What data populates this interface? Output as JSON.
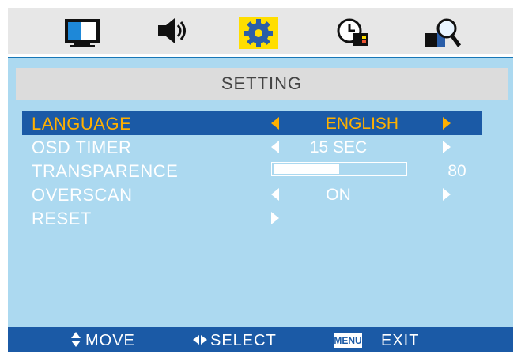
{
  "tabs": [
    {
      "name": "picture",
      "icon": "monitor-icon"
    },
    {
      "name": "audio",
      "icon": "speaker-icon"
    },
    {
      "name": "setting",
      "icon": "gear-icon",
      "active": true
    },
    {
      "name": "timer",
      "icon": "clock-icon"
    },
    {
      "name": "advanced",
      "icon": "magnifier-icon"
    }
  ],
  "panel": {
    "title": "SETTING"
  },
  "rows": [
    {
      "label": "LANGUAGE",
      "value": "ENGLISH",
      "selected": true
    },
    {
      "label": "OSD TIMER",
      "value": "15 SEC"
    },
    {
      "label": "TRANSPARENCE",
      "value": "80",
      "level": 0.5
    },
    {
      "label": "OVERSCAN",
      "value": "ON"
    },
    {
      "label": "RESET",
      "value": ""
    }
  ],
  "footer": {
    "move": "MOVE",
    "select": "SELECT",
    "menu_key": "MENU",
    "exit": "EXIT"
  },
  "colors": {
    "accent": "#1b5aa6",
    "panel_bg": "#acd9f0",
    "highlight_text": "#ffb000",
    "tab_bg": "#e7e7e7"
  }
}
